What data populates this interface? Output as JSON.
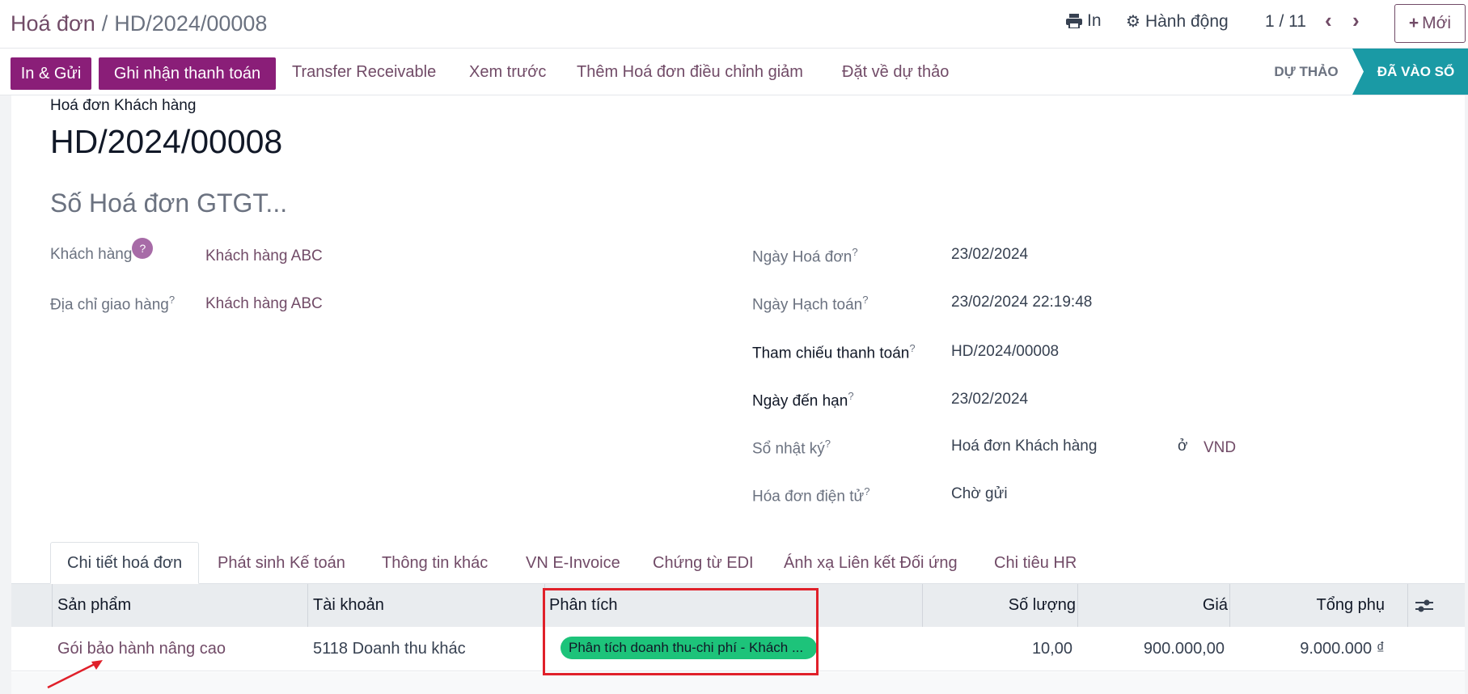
{
  "breadcrumb": {
    "parent": "Hoá đơn",
    "separator": "/",
    "current": "HD/2024/00008"
  },
  "toolbar": {
    "print_label": "In",
    "action_label": "Hành động",
    "pager": "1 / 11",
    "new_label": "Mới"
  },
  "buttons": {
    "send_print": "In & Gửi",
    "register_payment": "Ghi nhận thanh toán",
    "transfer_receivable": "Transfer Receivable",
    "preview": "Xem trước",
    "add_credit_note": "Thêm Hoá đơn điều chỉnh giảm",
    "reset_draft": "Đặt về dự thảo"
  },
  "status": {
    "draft": "DỰ THẢO",
    "posted": "ĐÃ VÀO SỔ",
    "current": "posted"
  },
  "form": {
    "doc_type": "Hoá đơn Khách hàng",
    "number": "HD/2024/00008",
    "vat_placeholder": "Số Hoá đơn GTGT...",
    "left_fields": {
      "customer_label": "Khách hàng",
      "customer_help": "?",
      "customer_value": "Khách hàng ABC",
      "delivery_label": "Địa chỉ giao hàng",
      "delivery_value": "Khách hàng ABC"
    },
    "right_fields": {
      "invoice_date_label": "Ngày Hoá đơn",
      "invoice_date_value": "23/02/2024",
      "accounting_date_label": "Ngày Hạch toán",
      "accounting_date_value": "23/02/2024 22:19:48",
      "payment_ref_label": "Tham chiếu thanh toán",
      "payment_ref_value": "HD/2024/00008",
      "due_date_label": "Ngày đến hạn",
      "due_date_value": "23/02/2024",
      "journal_label": "Sổ nhật ký",
      "journal_value": "Hoá đơn Khách hàng",
      "journal_in": "ở",
      "currency": "VND",
      "einvoice_label": "Hóa đơn điện tử",
      "einvoice_value": "Chờ gửi"
    },
    "help_mark": "?"
  },
  "tabs": [
    "Chi tiết hoá đơn",
    "Phát sinh Kế toán",
    "Thông tin khác",
    "VN E-Invoice",
    "Chứng từ EDI",
    "Ánh xạ Liên kết Đối ứng",
    "Chi tiêu HR"
  ],
  "table": {
    "headers": {
      "product": "Sản phẩm",
      "account": "Tài khoản",
      "analytic": "Phân tích",
      "quantity": "Số lượng",
      "price": "Giá",
      "subtotal": "Tổng phụ"
    },
    "rows": [
      {
        "product": "Gói bảo hành nâng cao",
        "account": "5118 Doanh thu khác",
        "analytic": "Phân tích doanh thu-chi phí - Khách ...",
        "quantity": "10,00",
        "price": "900.000,00",
        "subtotal": "9.000.000 ₫"
      }
    ]
  },
  "colors": {
    "primary": "#714b67",
    "button": "#8a1e78",
    "posted": "#1a9aa5",
    "tag": "#1dc37a",
    "highlight": "#e0202a"
  }
}
